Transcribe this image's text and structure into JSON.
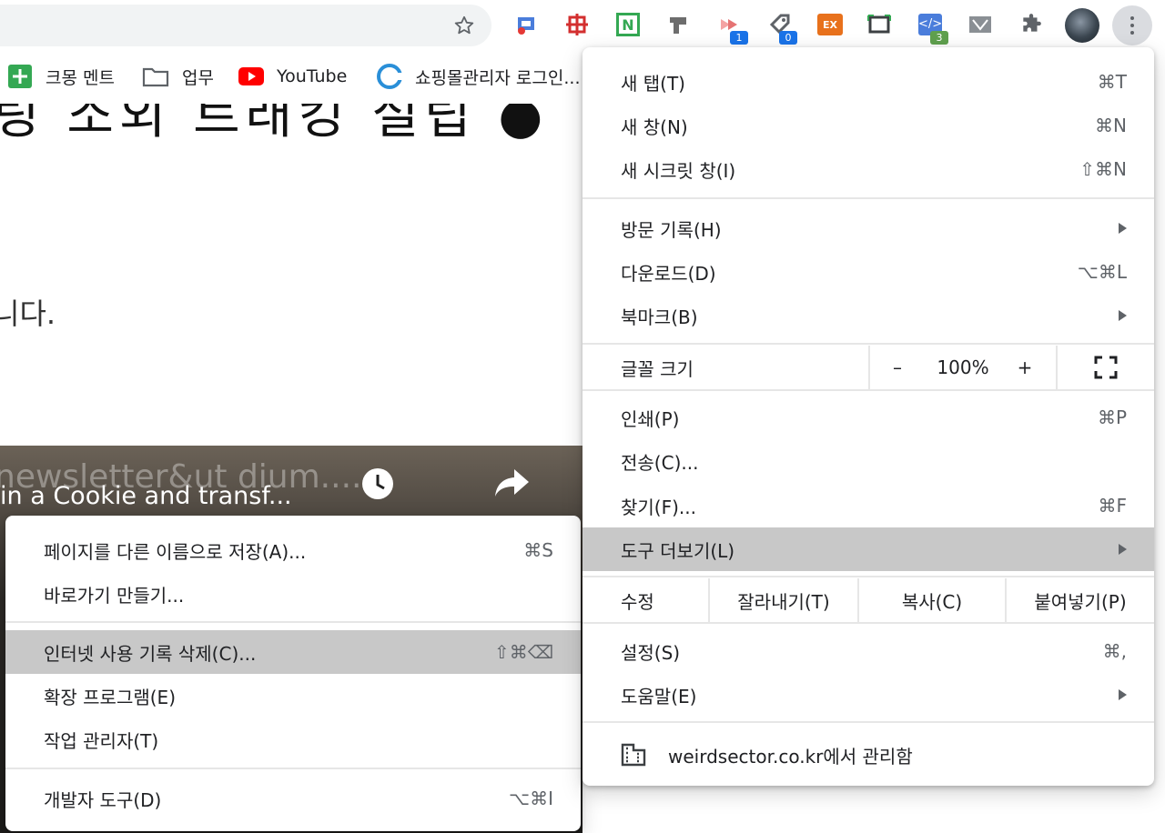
{
  "extensions": [
    {
      "name": "ext-1",
      "badge": ""
    },
    {
      "name": "ext-2",
      "badge": ""
    },
    {
      "name": "ext-n",
      "badge": ""
    },
    {
      "name": "ext-4",
      "badge": ""
    },
    {
      "name": "ext-5",
      "badge": "1"
    },
    {
      "name": "ext-6",
      "badge": "0"
    },
    {
      "name": "ext-ex",
      "badge": ""
    },
    {
      "name": "ext-screenshot",
      "badge": ""
    },
    {
      "name": "ext-code",
      "badge": "3"
    },
    {
      "name": "ext-10",
      "badge": ""
    }
  ],
  "ext_texts": {
    "n": "N",
    "ex": "EX"
  },
  "bookmarks": [
    {
      "label": "크몽 멘트",
      "icon": "green-plus-icon"
    },
    {
      "label": "업무",
      "icon": "folder-icon"
    },
    {
      "label": "YouTube",
      "icon": "youtube-icon"
    },
    {
      "label": "쇼핑몰관리자 로그인...",
      "icon": "cafe24-icon"
    }
  ],
  "page": {
    "title": "링 소외 트래킹 설립 ●",
    "paragraph": "니다.",
    "video_bg_text": "newsletter&ut     dium.....",
    "video_title": "in a Cookie and transf..."
  },
  "main_menu": {
    "new_tab": {
      "label": "새 탭(T)",
      "shortcut": "⌘T"
    },
    "new_window": {
      "label": "새 창(N)",
      "shortcut": "⌘N"
    },
    "incognito": {
      "label": "새 시크릿 창(I)",
      "shortcut": "⇧⌘N"
    },
    "history": {
      "label": "방문 기록(H)"
    },
    "downloads": {
      "label": "다운로드(D)",
      "shortcut": "⌥⌘L"
    },
    "bookmarks": {
      "label": "북마크(B)"
    },
    "zoom": {
      "label": "글꼴 크기",
      "minus": "–",
      "value": "100%",
      "plus": "+"
    },
    "print": {
      "label": "인쇄(P)",
      "shortcut": "⌘P"
    },
    "cast": {
      "label": "전송(C)..."
    },
    "find": {
      "label": "찾기(F)...",
      "shortcut": "⌘F"
    },
    "more_tools": {
      "label": "도구 더보기(L)"
    },
    "edit": {
      "label": "수정",
      "cut": "잘라내기(T)",
      "copy": "복사(C)",
      "paste": "붙여넣기(P)"
    },
    "settings": {
      "label": "설정(S)",
      "shortcut": "⌘,"
    },
    "help": {
      "label": "도움말(E)"
    },
    "managed": {
      "label": "weirdsector.co.kr에서 관리함"
    }
  },
  "sub_menu": {
    "save_page": {
      "label": "페이지를 다른 이름으로 저장(A)...",
      "shortcut": "⌘S"
    },
    "create_shortcut": {
      "label": "바로가기 만들기..."
    },
    "clear_data": {
      "label": "인터넷 사용 기록 삭제(C)...",
      "shortcut": "⇧⌘⌫"
    },
    "extensions": {
      "label": "확장 프로그램(E)"
    },
    "task_manager": {
      "label": "작업 관리자(T)"
    },
    "dev_tools": {
      "label": "개발자 도구(D)",
      "shortcut": "⌥⌘I"
    }
  },
  "colors": {
    "highlight": "#c8c8c8",
    "youtube": "#ff0000",
    "green_ext": "#34a853",
    "ex_ext": "#e8711c",
    "badge_blue": "#1a73e8",
    "badge_green": "#5fa04e"
  }
}
